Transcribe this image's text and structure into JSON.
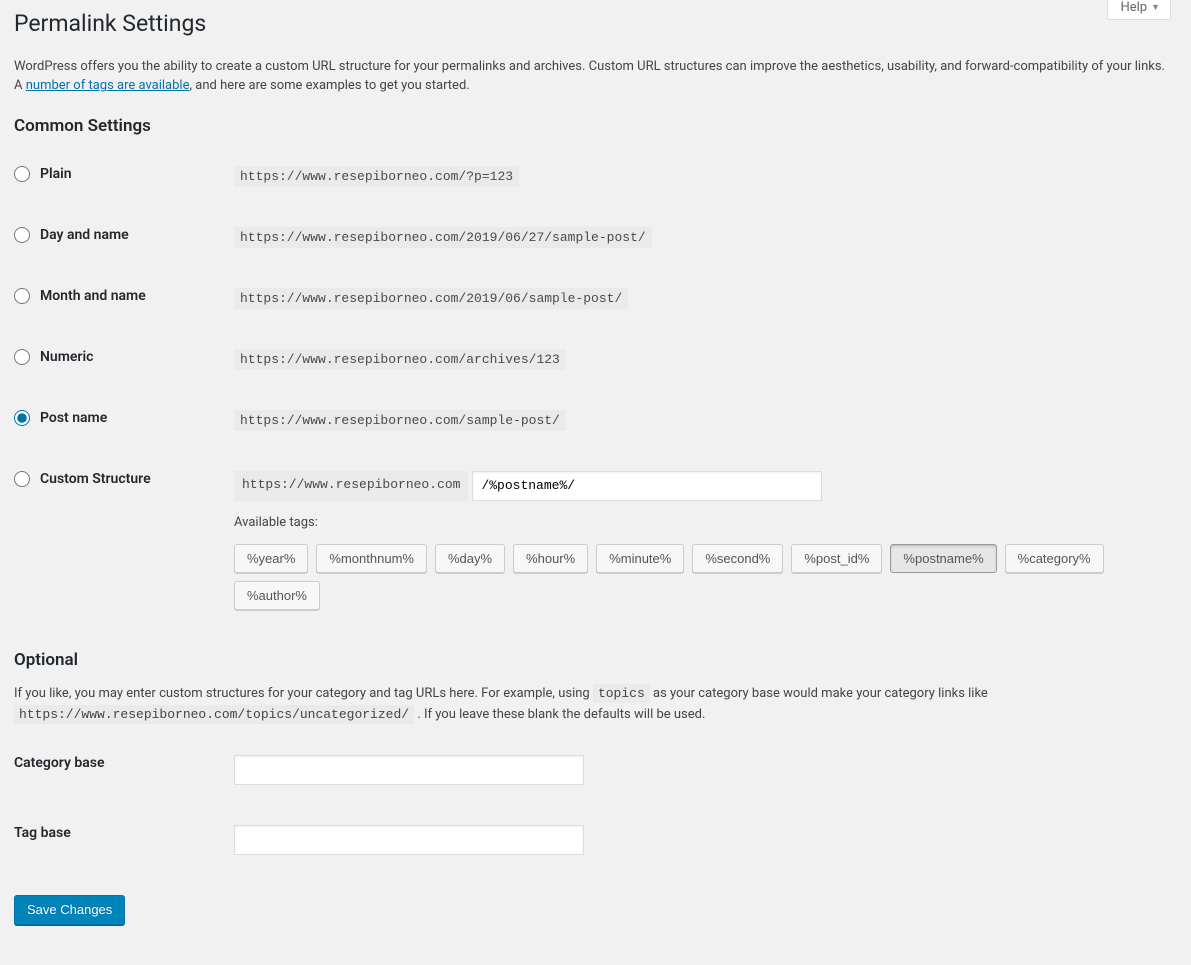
{
  "help_tab": "Help",
  "page_title": "Permalink Settings",
  "intro_pre": "WordPress offers you the ability to create a custom URL structure for your permalinks and archives. Custom URL structures can improve the aesthetics, usability, and forward-compatibility of your links. A ",
  "intro_link": "number of tags are available",
  "intro_post": ", and here are some examples to get you started.",
  "common_heading": "Common Settings",
  "options": {
    "plain": {
      "label": "Plain",
      "sample": "https://www.resepiborneo.com/?p=123"
    },
    "day": {
      "label": "Day and name",
      "sample": "https://www.resepiborneo.com/2019/06/27/sample-post/"
    },
    "month": {
      "label": "Month and name",
      "sample": "https://www.resepiborneo.com/2019/06/sample-post/"
    },
    "numeric": {
      "label": "Numeric",
      "sample": "https://www.resepiborneo.com/archives/123"
    },
    "postname": {
      "label": "Post name",
      "sample": "https://www.resepiborneo.com/sample-post/"
    },
    "custom": {
      "label": "Custom Structure",
      "base": "https://www.resepiborneo.com",
      "value": "/%postname%/"
    }
  },
  "available_tags_label": "Available tags:",
  "tags": [
    "%year%",
    "%monthnum%",
    "%day%",
    "%hour%",
    "%minute%",
    "%second%",
    "%post_id%",
    "%postname%",
    "%category%",
    "%author%"
  ],
  "active_tag_index": 7,
  "optional_heading": "Optional",
  "optional_desc_pre": "If you like, you may enter custom structures for your category and tag URLs here. For example, using ",
  "optional_code1": "topics",
  "optional_desc_mid": " as your category base would make your category links like ",
  "optional_code2": "https://www.resepiborneo.com/topics/uncategorized/",
  "optional_desc_post": " . If you leave these blank the defaults will be used.",
  "category_base_label": "Category base",
  "category_base_value": "",
  "tag_base_label": "Tag base",
  "tag_base_value": "",
  "submit_label": "Save Changes"
}
